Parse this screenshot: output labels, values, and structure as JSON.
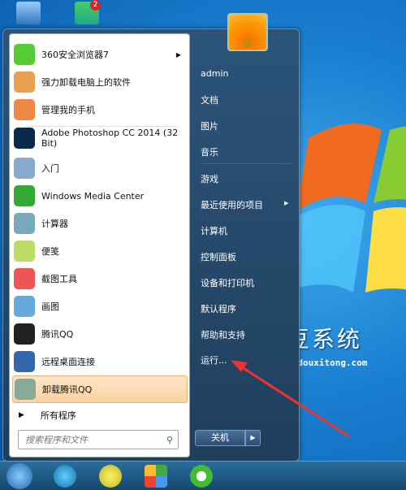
{
  "left_items": [
    {
      "label": "360安全浏览器7",
      "icon": "360-browser-icon",
      "color": "#5c3",
      "submenu": true
    },
    {
      "label": "强力卸载电脑上的软件",
      "icon": "uninstall-box-icon",
      "color": "#e9a050"
    },
    {
      "label": "管理我的手机",
      "icon": "phone-manager-icon",
      "color": "#e84"
    },
    {
      "label": "Adobe Photoshop CC 2014 (32 Bit)",
      "icon": "photoshop-icon",
      "color": "#0b2a4a"
    },
    {
      "label": "入门",
      "icon": "getting-started-icon",
      "color": "#8ac"
    },
    {
      "label": "Windows Media Center",
      "icon": "media-center-icon",
      "color": "#3a3"
    },
    {
      "label": "计算器",
      "icon": "calculator-icon",
      "color": "#7ab"
    },
    {
      "label": "便笺",
      "icon": "sticky-notes-icon",
      "color": "#bd6"
    },
    {
      "label": "截图工具",
      "icon": "snipping-tool-icon",
      "color": "#e55"
    },
    {
      "label": "画图",
      "icon": "paint-icon",
      "color": "#6ad"
    },
    {
      "label": "腾讯QQ",
      "icon": "qq-icon",
      "color": "#222"
    },
    {
      "label": "远程桌面连接",
      "icon": "remote-desktop-icon",
      "color": "#36a"
    },
    {
      "label": "卸载腾讯QQ",
      "icon": "recycle-bin-icon",
      "color": "#8a9",
      "highlighted": true
    }
  ],
  "all_programs": "所有程序",
  "search_placeholder": "搜索程序和文件",
  "right_items": [
    "admin",
    "文档",
    "图片",
    "音乐",
    "游戏",
    "最近使用的项目",
    "计算机",
    "控制面板",
    "设备和打印机",
    "默认程序",
    "帮助和支持",
    "运行..."
  ],
  "shutdown_label": "关机",
  "watermark": {
    "title": "豆豆系统",
    "url": "www.doudouxitong.com"
  },
  "desktop_badge": "2"
}
